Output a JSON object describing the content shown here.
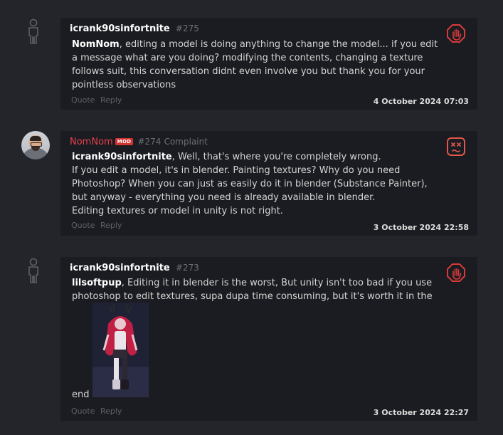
{
  "posts": [
    {
      "author": "icrank90sinfortnite",
      "post_number": "#275",
      "mention": "NomNom",
      "body": ", editing a model is doing anything to change the model... if you edit a message what are you doing? modifying the contents, changing a texture follows suit, this conversation didnt even involve you but thank you for your pointless observations",
      "quote_label": "Quote",
      "reply_label": "Reply",
      "date": "4 October 2024 07:03",
      "badge_icon": "stop-hand-icon",
      "avatar": "silhouette"
    },
    {
      "author": "NomNom",
      "mod_badge": "MOD",
      "post_number": "#274",
      "complaint_label": "Complaint",
      "mention": "icrank90sinfortnite",
      "body_lines": [
        ", Well, that's where you're completely wrong.",
        "If you edit a model, it's in blender. Painting textures? Why do you need Photoshop? When you can just as easily do it in blender (Substance Painter), but anyway - everything you need is already available in blender.",
        "Editing textures or model in unity is not right."
      ],
      "quote_label": "Quote",
      "reply_label": "Reply",
      "date": "3 October 2024 22:58",
      "badge_icon": "dizzy-face-icon",
      "avatar": "photo"
    },
    {
      "author": "icrank90sinfortnite",
      "post_number": "#273",
      "mention": "lilsoftpup",
      "body": ", Editing it in blender is the worst, But unity isn't too bad if you use photoshop to edit textures, supa dupa time consuming, but it's worth it in the",
      "trailing_word": "end",
      "quote_label": "Quote",
      "reply_label": "Reply",
      "date": "3 October 2024 22:27",
      "badge_icon": "stop-hand-icon",
      "avatar": "silhouette"
    }
  ],
  "colors": {
    "background": "#23252a",
    "card": "#1b1c21",
    "mod_red": "#e4424d",
    "badge_red": "#d3342f"
  }
}
